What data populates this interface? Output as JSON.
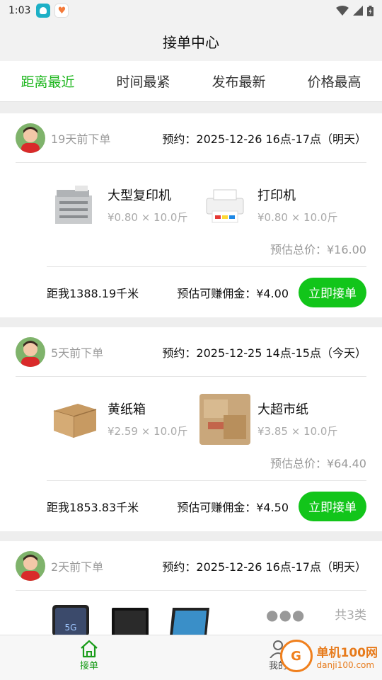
{
  "status": {
    "time": "1:03"
  },
  "header": {
    "title": "接单中心"
  },
  "tabs": [
    {
      "label": "距离最近",
      "active": true
    },
    {
      "label": "时间最紧",
      "active": false
    },
    {
      "label": "发布最新",
      "active": false
    },
    {
      "label": "价格最高",
      "active": false
    }
  ],
  "orders": [
    {
      "ordered_ago": "19天前下单",
      "appointment": "预约：2025-12-26 16点-17点（明天）",
      "items": [
        {
          "name": "大型复印机",
          "price": "¥0.80 × 10.0斤",
          "icon": "copier-icon"
        },
        {
          "name": "打印机",
          "price": "¥0.80 × 10.0斤",
          "icon": "printer-icon"
        }
      ],
      "total": "预估总价：¥16.00",
      "distance": "距我1388.19千米",
      "commission": "预估可赚佣金：¥4.00",
      "accept_label": "立即接单"
    },
    {
      "ordered_ago": "5天前下单",
      "appointment": "预约：2025-12-25 14点-15点（今天）",
      "items": [
        {
          "name": "黄纸箱",
          "price": "¥2.59 × 10.0斤",
          "icon": "cardboard-box-icon"
        },
        {
          "name": "大超市纸",
          "price": "¥3.85 × 10.0斤",
          "icon": "flattened-boxes-icon"
        }
      ],
      "total": "预估总价：¥64.40",
      "distance": "距我1853.83千米",
      "commission": "预估可赚佣金：¥4.50",
      "accept_label": "立即接单"
    },
    {
      "ordered_ago": "2天前下单",
      "appointment": "预约：2025-12-26 16点-17点（明天）",
      "more_count": "共3类"
    }
  ],
  "nav": {
    "left_label": "接单",
    "right_label": "我的"
  },
  "watermark": {
    "brand": "单机100网",
    "url": "danji100.com"
  },
  "colors": {
    "accent": "#12c51a",
    "tab_active": "#1bb51b"
  }
}
